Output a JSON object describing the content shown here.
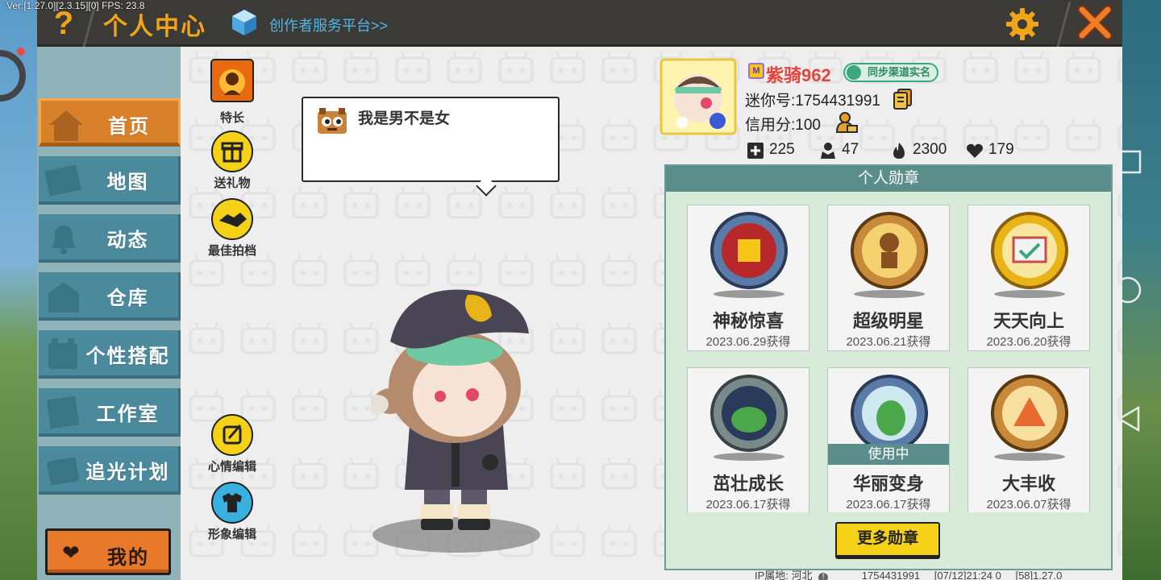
{
  "version_text": "Ver:[1.27.0][2.3.15][0] FPS: 23.8",
  "topbar": {
    "help_label": "?",
    "title": "个人中心",
    "creator_link": "创作者服务平台>>"
  },
  "nav": {
    "items": [
      {
        "label": "首页",
        "icon": "home-icon",
        "active": true
      },
      {
        "label": "地图",
        "icon": "map-icon",
        "active": false
      },
      {
        "label": "动态",
        "icon": "bell-icon",
        "active": false
      },
      {
        "label": "仓库",
        "icon": "warehouse-icon",
        "active": false
      },
      {
        "label": "个性搭配",
        "icon": "outfit-icon",
        "active": false
      },
      {
        "label": "工作室",
        "icon": "studio-icon",
        "active": false
      },
      {
        "label": "追光计划",
        "icon": "lightchase-icon",
        "active": false
      }
    ],
    "my_button": "我的"
  },
  "side_actions": {
    "specialty": "特长",
    "send_gift": "送礼物",
    "best_partner": "最佳拍档",
    "mood_edit": "心情编辑",
    "avatar_edit": "形象编辑"
  },
  "bubble": {
    "text": "我是男不是女"
  },
  "profile": {
    "vip_label": "M",
    "username": "紫骑962",
    "sync_badge": "同步渠道实名",
    "mini_id": "迷你号:1754431991",
    "credit": "信用分:100",
    "stats": {
      "friends": "225",
      "fans": "47",
      "popularity": "2300",
      "likes": "179"
    }
  },
  "badges": {
    "header": "个人勋章",
    "items": [
      {
        "name": "神秘惊喜",
        "date": "2023.06.29获得",
        "in_use": false,
        "color": "#5a7aa8"
      },
      {
        "name": "超级明星",
        "date": "2023.06.21获得",
        "in_use": false,
        "color": "#c88a3a"
      },
      {
        "name": "天天向上",
        "date": "2023.06.20获得",
        "in_use": false,
        "color": "#e8b418"
      },
      {
        "name": "茁壮成长",
        "date": "2023.06.17获得",
        "in_use": false,
        "color": "#7a8a8a"
      },
      {
        "name": "华丽变身",
        "date": "2023.06.17获得",
        "in_use": true,
        "color": "#5a7aa8"
      },
      {
        "name": "大丰收",
        "date": "2023.06.07获得",
        "in_use": false,
        "color": "#c88a3a"
      }
    ],
    "in_use_label": "使用中",
    "more_button": "更多勋章"
  },
  "footer": {
    "ip_location": "IP属地: 河北",
    "id": "1754431991",
    "time": "[07/12]21:24 0",
    "build": "[58]1.27.0"
  },
  "colors": {
    "accent_orange": "#f2a418",
    "nav_teal": "#4a8a9c",
    "nav_active": "#d8812a",
    "badge_header": "#5b8d8a",
    "username_red": "#e2463d"
  }
}
